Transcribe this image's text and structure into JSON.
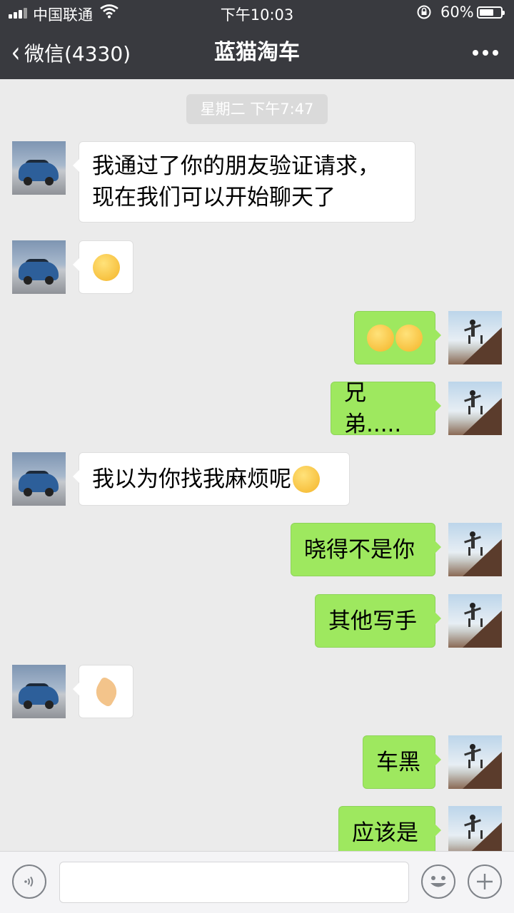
{
  "status_bar": {
    "carrier": "中国联通",
    "time": "下午10:03",
    "battery": "60%",
    "battery_level": 0.6,
    "wifi_icon": "wifi-icon",
    "lock_icon": "rotation-lock-icon"
  },
  "header": {
    "back_label": "微信(4330)",
    "title": "蓝猫淘车",
    "more_icon": "more-icon"
  },
  "chat": {
    "timestamp": "星期二 下午7:47",
    "messages": [
      {
        "side": "in",
        "text": "我通过了你的朋友验证请求，",
        "text2": "现在我们可以开始聊天了"
      },
      {
        "side": "in",
        "text": "",
        "emoji": "facepalm-emoji"
      },
      {
        "side": "out",
        "text": "",
        "emoji": "smirk-emoji x2"
      },
      {
        "side": "out",
        "text": "兄弟....."
      },
      {
        "side": "in",
        "text": "我以为你找我麻烦呢",
        "emoji": "tears-of-joy-emoji"
      },
      {
        "side": "out",
        "text": "晓得不是你"
      },
      {
        "side": "out",
        "text": "其他写手"
      },
      {
        "side": "in",
        "text": "",
        "emoji": "ok-hand-emoji"
      },
      {
        "side": "out",
        "text": "车黑"
      },
      {
        "side": "out",
        "text": "应该是"
      }
    ]
  },
  "colors": {
    "header_bg": "#393a3f",
    "chat_bg": "#ebebeb",
    "out_bubble": "#9ee85f",
    "in_bubble": "#ffffff"
  }
}
